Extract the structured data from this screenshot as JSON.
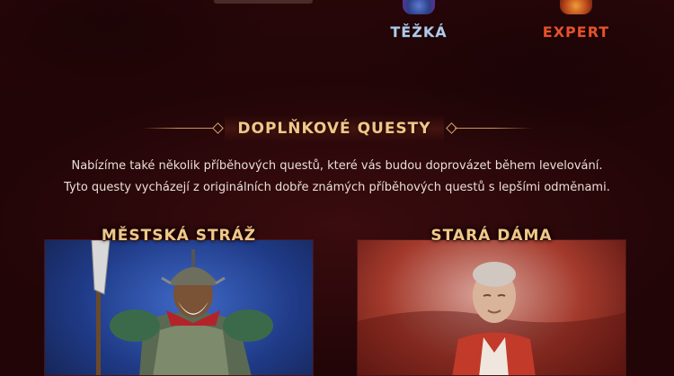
{
  "difficulties": [
    {
      "label": "TĚŽKÁ",
      "icon": "hard-difficulty-icon",
      "color": "#b7c6e6"
    },
    {
      "label": "EXPERT",
      "icon": "expert-difficulty-icon",
      "color": "#e4522a"
    }
  ],
  "section": {
    "title": "DOPLŇKOVÉ QUESTY",
    "intro_line1": "Nabízíme také několik příběhových questů, které vás budou doprovázet během levelování.",
    "intro_line2": "Tyto questy vycházejí z originálních dobře známých příběhových questů s lepšími odměnami."
  },
  "cards": [
    {
      "title": "MĚSTSKÁ STRÁŽ",
      "image": "city-guard-portrait"
    },
    {
      "title": "STARÁ DÁMA",
      "image": "old-lady-portrait"
    }
  ],
  "colors": {
    "background": "#2a0709",
    "accent_gold": "#f0c78a",
    "text": "#eadfd6"
  }
}
